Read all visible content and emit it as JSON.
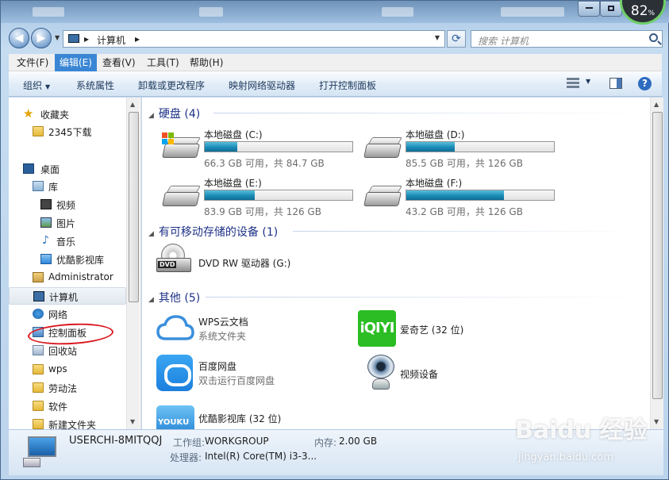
{
  "window": {
    "battery": "82",
    "battery_unit": "%"
  },
  "address": {
    "crumbs": [
      "计算机"
    ],
    "search_placeholder": "搜索 计算机"
  },
  "menu": [
    "文件(F)",
    "编辑(E)",
    "查看(V)",
    "工具(T)",
    "帮助(H)"
  ],
  "menu_active_index": 1,
  "commands": {
    "organize": "组织",
    "sysprops": "系统属性",
    "uninstall": "卸载或更改程序",
    "mapdrive": "映射网络驱动器",
    "controlpanel": "打开控制面板"
  },
  "nav": {
    "favorites": "收藏夹",
    "downloads": "2345下载",
    "desktop": "桌面",
    "libraries": "库",
    "video": "视频",
    "pictures": "图片",
    "music": "音乐",
    "youku": "优酷影视库",
    "admin": "Administrator",
    "computer": "计算机",
    "network": "网络",
    "controlpanel": "控制面板",
    "recycle": "回收站",
    "wps": "wps",
    "labor": "劳动法",
    "software": "软件",
    "newfolder": "新建文件夹"
  },
  "groups": {
    "hdd": "硬盘 (4)",
    "removable": "有可移动存储的设备 (1)",
    "other": "其他 (5)"
  },
  "drives": [
    {
      "name": "本地磁盘 (C:)",
      "free": "66.3 GB 可用，共 84.7 GB",
      "used_fraction": 0.22
    },
    {
      "name": "本地磁盘 (D:)",
      "free": "85.5 GB 可用，共 126 GB",
      "used_fraction": 0.33
    },
    {
      "name": "本地磁盘 (E:)",
      "free": "83.9 GB 可用，共 126 GB",
      "used_fraction": 0.34
    },
    {
      "name": "本地磁盘 (F:)",
      "free": "43.2 GB 可用，共 126 GB",
      "used_fraction": 0.66
    }
  ],
  "dvd": {
    "name": "DVD RW 驱动器 (G:)",
    "tag": "DVD"
  },
  "others": [
    {
      "name": "WPS云文档",
      "sub": "系统文件夹"
    },
    {
      "name": "爱奇艺 (32 位)",
      "sub": ""
    },
    {
      "name": "百度网盘",
      "sub": "双击运行百度网盘"
    },
    {
      "name": "视频设备",
      "sub": ""
    },
    {
      "name": "优酷影视库 (32 位)",
      "sub": "",
      "logo": "YOUKU"
    }
  ],
  "iqiyi_logo": "iQIYI",
  "details": {
    "pc_name": "USERCHI-8MITQQJ",
    "workgroup_label": "工作组:",
    "workgroup": "WORKGROUP",
    "memory_label": "内存:",
    "memory": "2.00 GB",
    "cpu_label": "处理器:",
    "cpu": "Intel(R) Core(TM) i3-3..."
  },
  "watermark": {
    "logo": "Baidu 经验",
    "url": "jingyan.baidu.com"
  },
  "colors": {
    "accent": "#3a86d4",
    "bar_fill": "#1b8bb7",
    "group_header": "#1e3287",
    "annotation": "#d9181f"
  }
}
